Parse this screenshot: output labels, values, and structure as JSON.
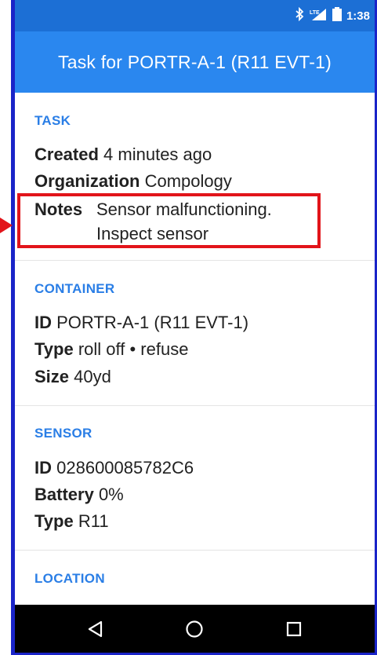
{
  "status_bar": {
    "time": "1:38",
    "icons": [
      "bluetooth-icon",
      "lte-signal-icon",
      "battery-icon"
    ],
    "lte_label": "LTE"
  },
  "app_bar": {
    "title": "Task for PORTR-A-1 (R11 EVT-1)"
  },
  "sections": {
    "task": {
      "title": "TASK",
      "created": {
        "label": "Created",
        "value": "4 minutes ago"
      },
      "organization": {
        "label": "Organization",
        "value": "Compology"
      },
      "notes": {
        "label": "Notes",
        "value_line1": "Sensor malfunctioning.",
        "value_line2": "Inspect sensor"
      }
    },
    "container": {
      "title": "CONTAINER",
      "id": {
        "label": "ID",
        "value": "PORTR-A-1 (R11 EVT-1)"
      },
      "type": {
        "label": "Type",
        "value": "roll off • refuse"
      },
      "size": {
        "label": "Size",
        "value": "40yd"
      }
    },
    "sensor": {
      "title": "SENSOR",
      "id": {
        "label": "ID",
        "value": "028600085782C6"
      },
      "battery": {
        "label": "Battery",
        "value": "0%"
      },
      "type": {
        "label": "Type",
        "value": "R11"
      }
    },
    "location": {
      "title": "LOCATION"
    }
  },
  "nav_bar": {
    "buttons": [
      "back-icon",
      "home-icon",
      "recents-icon"
    ]
  },
  "colors": {
    "status_bar": "#1c6fd5",
    "app_bar": "#2a87ef",
    "section_title": "#2a7ee6",
    "highlight": "#e2141a",
    "frame": "#1a24c8"
  }
}
